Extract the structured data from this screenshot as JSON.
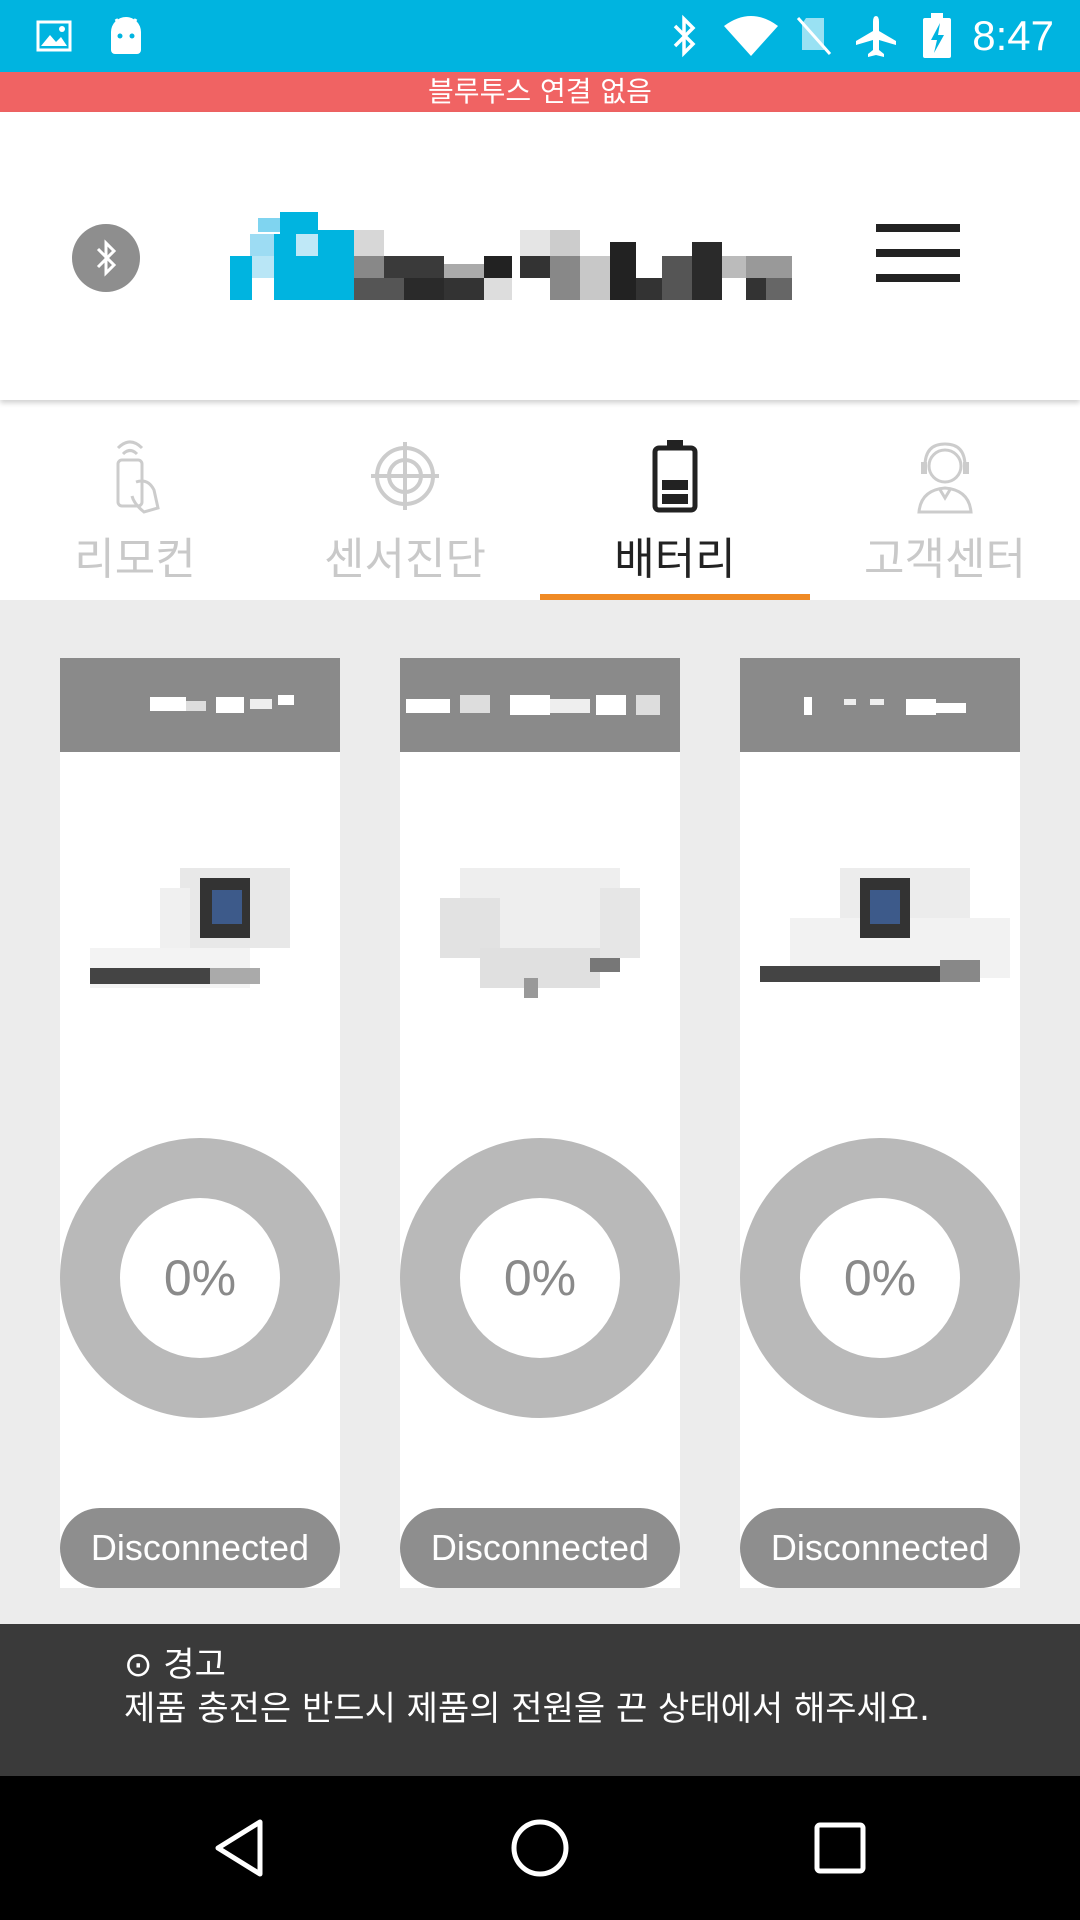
{
  "status_bar": {
    "time": "8:47",
    "icons": [
      "image-icon",
      "android-icon",
      "bluetooth-icon",
      "wifi-icon",
      "no-sim-icon",
      "airplane-icon",
      "battery-charging-icon"
    ]
  },
  "bluetooth_banner": "블루투스 연결 없음",
  "header": {
    "bluetooth_icon": "bluetooth-icon",
    "menu_icon": "hamburger-menu-icon"
  },
  "tabs": [
    {
      "label": "리모컨",
      "icon": "remote-hand-icon",
      "active": false
    },
    {
      "label": "센서진단",
      "icon": "crosshair-icon",
      "active": false
    },
    {
      "label": "배터리",
      "icon": "battery-icon",
      "active": true
    },
    {
      "label": "고객센터",
      "icon": "customer-support-icon",
      "active": false
    }
  ],
  "devices": [
    {
      "percent": "0%",
      "battery_level": 0,
      "status": "Disconnected"
    },
    {
      "percent": "0%",
      "battery_level": 0,
      "status": "Disconnected"
    },
    {
      "percent": "0%",
      "battery_level": 0,
      "status": "Disconnected"
    }
  ],
  "notice": {
    "title": "⊙ 경고",
    "body": "제품 충전은 반드시 제품의 전원을 끈 상태에서 해주세요."
  },
  "nav_bar": {
    "icons": [
      "back-icon",
      "home-icon",
      "recents-icon"
    ]
  },
  "colors": {
    "status_bar": "#00b4e0",
    "warning_strip": "#f06363",
    "active_tab_underline": "#f08a24",
    "gauge": "#b9b9b9",
    "card_title": "#8a8a8a",
    "notice_bg": "#3a3a3a"
  }
}
